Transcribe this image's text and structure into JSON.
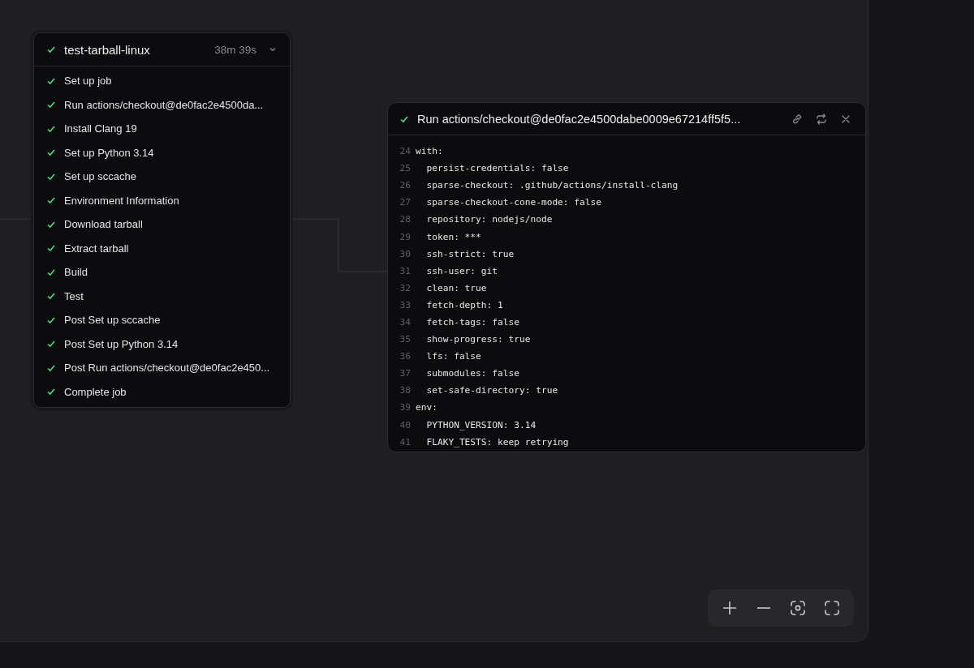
{
  "job": {
    "passed": true,
    "name": "test-tarball-linux",
    "duration": "38m 39s",
    "expanded": true,
    "steps": [
      {
        "label": "Set up job",
        "passed": true
      },
      {
        "label": "Run actions/checkout@de0fac2e4500da...",
        "passed": true
      },
      {
        "label": "Install Clang 19",
        "passed": true
      },
      {
        "label": "Set up Python 3.14",
        "passed": true
      },
      {
        "label": "Set up sccache",
        "passed": true
      },
      {
        "label": "Environment Information",
        "passed": true
      },
      {
        "label": "Download tarball",
        "passed": true
      },
      {
        "label": "Extract tarball",
        "passed": true
      },
      {
        "label": "Build",
        "passed": true
      },
      {
        "label": "Test",
        "passed": true
      },
      {
        "label": "Post Set up sccache",
        "passed": true
      },
      {
        "label": "Post Set up Python 3.14",
        "passed": true
      },
      {
        "label": "Post Run actions/checkout@de0fac2e450...",
        "passed": true
      },
      {
        "label": "Complete job",
        "passed": true
      }
    ]
  },
  "step_panel": {
    "passed": true,
    "title": "Run actions/checkout@de0fac2e4500dabe0009e67214ff5f5...",
    "lines": [
      {
        "number": "24",
        "text": "with:"
      },
      {
        "number": "25",
        "text": "  persist-credentials: false"
      },
      {
        "number": "26",
        "text": "  sparse-checkout: .github/actions/install-clang"
      },
      {
        "number": "27",
        "text": "  sparse-checkout-cone-mode: false"
      },
      {
        "number": "28",
        "text": "  repository: nodejs/node"
      },
      {
        "number": "29",
        "text": "  token: ***"
      },
      {
        "number": "30",
        "text": "  ssh-strict: true"
      },
      {
        "number": "31",
        "text": "  ssh-user: git"
      },
      {
        "number": "32",
        "text": "  clean: true"
      },
      {
        "number": "33",
        "text": "  fetch-depth: 1"
      },
      {
        "number": "34",
        "text": "  fetch-tags: false"
      },
      {
        "number": "35",
        "text": "  show-progress: true"
      },
      {
        "number": "36",
        "text": "  lfs: false"
      },
      {
        "number": "37",
        "text": "  submodules: false"
      },
      {
        "number": "38",
        "text": "  set-safe-directory: true"
      },
      {
        "number": "39",
        "text": "env:"
      },
      {
        "number": "40",
        "text": "  PYTHON_VERSION: 3.14"
      },
      {
        "number": "41",
        "text": "  FLAKY_TESTS: keep retrying"
      }
    ]
  }
}
